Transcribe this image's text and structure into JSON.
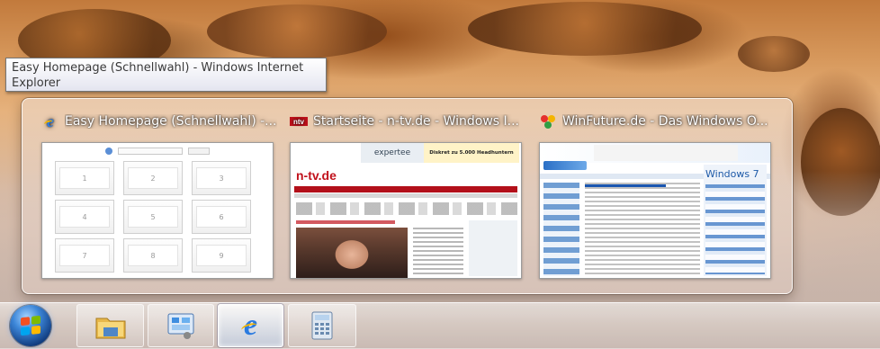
{
  "tooltip": {
    "text": "Easy Homepage (Schnellwahl) - Windows Internet Explorer"
  },
  "thumbnails": [
    {
      "title": "Easy Homepage (Schnellwahl) -...",
      "icon": "ie-icon",
      "speed_dial": [
        "1",
        "2",
        "3",
        "4",
        "5",
        "6",
        "7",
        "8",
        "9"
      ]
    },
    {
      "title": "Startseite - n-tv.de - Windows I...",
      "icon": "ntv-icon",
      "logo": "n-tv.de",
      "ad_brand": "expertee",
      "ad_text": "Diskret zu 5.000 Headhuntern"
    },
    {
      "title": "WinFuture.de - Das Windows O...",
      "icon": "winfuture-icon",
      "promo": "Windows 7"
    }
  ],
  "taskbar": {
    "items": [
      {
        "name": "start-button",
        "icon": "windows-orb-icon"
      },
      {
        "name": "explorer",
        "icon": "folder-icon"
      },
      {
        "name": "control-panel",
        "icon": "control-panel-icon"
      },
      {
        "name": "internet-explorer",
        "icon": "ie-icon",
        "active": true
      },
      {
        "name": "calculator",
        "icon": "calculator-icon"
      }
    ]
  }
}
